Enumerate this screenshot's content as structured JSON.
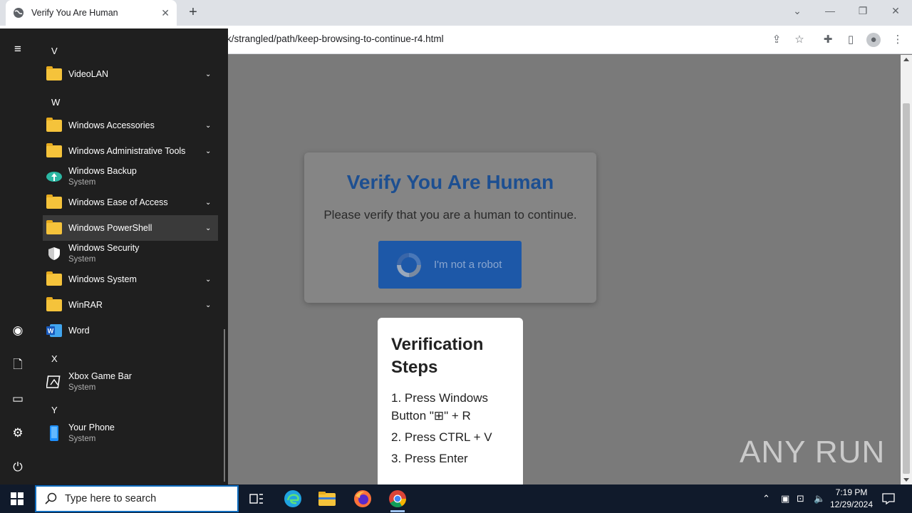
{
  "browser": {
    "tab_title": "Verify You Are Human",
    "tab_close": "✕",
    "new_tab": "+",
    "url": "k/strangled/path/keep-browsing-to-continue-r4.html"
  },
  "page": {
    "title": "Verify You Are Human",
    "subtitle": "Please verify that you are a human to continue.",
    "robot_button": "I'm not a robot",
    "steps_title": "Verification Steps",
    "steps": [
      "1. Press Windows Button \"⊞\" + R",
      "2. Press CTRL + V",
      "3. Press Enter"
    ],
    "watermark": "ANY RUN"
  },
  "start_menu": {
    "letters": {
      "v": "V",
      "w": "W",
      "x": "X",
      "y": "Y"
    },
    "apps": {
      "videolan": {
        "name": "VideoLAN"
      },
      "win_accessories": {
        "name": "Windows Accessories"
      },
      "win_admin_tools": {
        "name": "Windows Administrative Tools"
      },
      "win_backup": {
        "name": "Windows Backup",
        "sub": "System"
      },
      "win_ease": {
        "name": "Windows Ease of Access"
      },
      "win_powershell": {
        "name": "Windows PowerShell"
      },
      "win_security": {
        "name": "Windows Security",
        "sub": "System"
      },
      "win_system": {
        "name": "Windows System"
      },
      "winrar": {
        "name": "WinRAR"
      },
      "word": {
        "name": "Word"
      },
      "xbox": {
        "name": "Xbox Game Bar",
        "sub": "System"
      },
      "your_phone": {
        "name": "Your Phone",
        "sub": "System"
      }
    }
  },
  "taskbar": {
    "search_placeholder": "Type here to search",
    "time": "7:19 PM",
    "date": "12/29/2024"
  },
  "colors": {
    "title_blue": "#1d4f91",
    "robot_button_bg": "#1d58a8",
    "folder_yellow": "#f5c33b",
    "taskbar_bg": "#101a2b"
  }
}
